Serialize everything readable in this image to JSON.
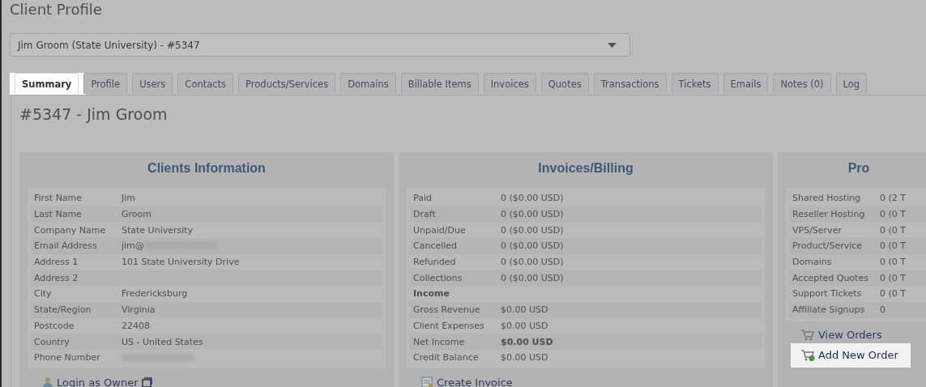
{
  "page_title": "Client Profile",
  "client_select": {
    "value": "Jim Groom (State University) - #5347"
  },
  "tabs": [
    {
      "label": "Summary",
      "selected": true,
      "highlighted": true
    },
    {
      "label": "Profile",
      "selected": false,
      "highlighted": false
    },
    {
      "label": "Users",
      "selected": false,
      "highlighted": false
    },
    {
      "label": "Contacts",
      "selected": false,
      "highlighted": false
    },
    {
      "label": "Products/Services",
      "selected": false,
      "highlighted": false
    },
    {
      "label": "Domains",
      "selected": false,
      "highlighted": false
    },
    {
      "label": "Billable Items",
      "selected": false,
      "highlighted": false
    },
    {
      "label": "Invoices",
      "selected": false,
      "highlighted": false
    },
    {
      "label": "Quotes",
      "selected": false,
      "highlighted": false
    },
    {
      "label": "Transactions",
      "selected": false,
      "highlighted": false
    },
    {
      "label": "Tickets",
      "selected": false,
      "highlighted": false
    },
    {
      "label": "Emails",
      "selected": false,
      "highlighted": false
    },
    {
      "label": "Notes (0)",
      "selected": false,
      "highlighted": false
    },
    {
      "label": "Log",
      "selected": false,
      "highlighted": false
    }
  ],
  "client_heading": "#5347 - Jim Groom",
  "panels": [
    {
      "title": "Clients Information",
      "rows": [
        {
          "label": "First Name",
          "value": "Jim"
        },
        {
          "label": "Last Name",
          "value": "Groom"
        },
        {
          "label": "Company Name",
          "value": "State University"
        },
        {
          "label": "Email Address",
          "value": "jim@",
          "redacted": true
        },
        {
          "label": "Address 1",
          "value": "101 State University Drive"
        },
        {
          "label": "Address 2"
        },
        {
          "label": "City",
          "value": "Fredericksburg"
        },
        {
          "label": "State/Region",
          "value": "Virginia"
        },
        {
          "label": "Postcode",
          "value": "22408"
        },
        {
          "label": "Country",
          "value": "US - United States"
        },
        {
          "label": "Phone Number",
          "redacted": true
        }
      ],
      "links": [
        {
          "label": "Login as Owner",
          "kind": "login",
          "highlighted": false
        }
      ]
    },
    {
      "title": "Invoices/Billing",
      "rows": [
        {
          "label": "Paid",
          "value": "0 ($0.00 USD)"
        },
        {
          "label": "Draft",
          "value": "0 ($0.00 USD)"
        },
        {
          "label": "Unpaid/Due",
          "value": "0 ($0.00 USD)"
        },
        {
          "label": "Cancelled",
          "value": "0 ($0.00 USD)"
        },
        {
          "label": "Refunded",
          "value": "0 ($0.00 USD)"
        },
        {
          "label": "Collections",
          "value": "0 ($0.00 USD)"
        },
        {
          "label": "Income",
          "kind": "section"
        },
        {
          "label": "Gross Revenue",
          "value": "$0.00 USD"
        },
        {
          "label": "Client Expenses",
          "value": "$0.00 USD"
        },
        {
          "label": "Net Income",
          "value": "$0.00 USD",
          "bold": true
        },
        {
          "label": "Credit Balance",
          "value": "$0.00 USD"
        }
      ],
      "links": [
        {
          "label": "Create Invoice",
          "kind": "invoice",
          "highlighted": false
        }
      ]
    },
    {
      "title": "Pro",
      "rows": [
        {
          "label": "Shared Hosting",
          "value": "0 (2 T"
        },
        {
          "label": "Reseller Hosting",
          "value": "0 (0 T"
        },
        {
          "label": "VPS/Server",
          "value": "0 (0 T"
        },
        {
          "label": "Product/Service",
          "value": "0 (0 T"
        },
        {
          "label": "Domains",
          "value": "0 (0 T"
        },
        {
          "label": "Accepted Quotes",
          "value": "0 (0 T"
        },
        {
          "label": "Support Tickets",
          "value": "0 (0 T"
        },
        {
          "label": "Affiliate Signups",
          "value": "0"
        }
      ],
      "links": [
        {
          "label": "View Orders",
          "kind": "orders",
          "highlighted": false
        },
        {
          "label": "Add New Order",
          "kind": "add-order",
          "highlighted": true
        }
      ]
    }
  ]
}
